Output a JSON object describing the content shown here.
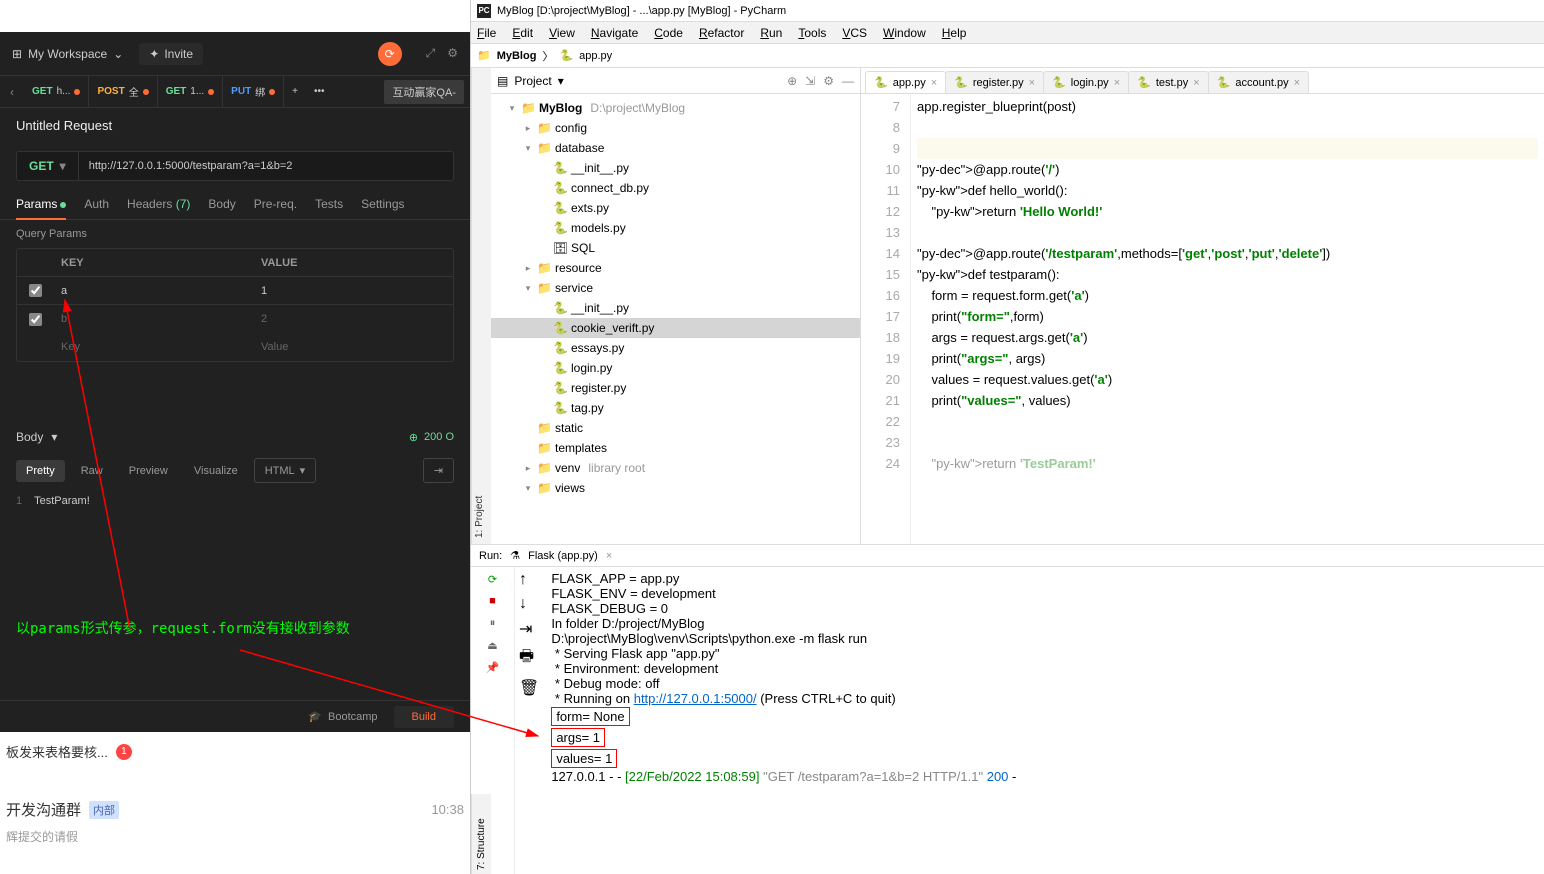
{
  "postman": {
    "workspace": "My Workspace",
    "invite": "Invite",
    "tabs": [
      {
        "method": "GET",
        "label": "h...",
        "color": "#6bdd9a"
      },
      {
        "method": "POST",
        "label": "全",
        "color": "#ffb13b"
      },
      {
        "method": "GET",
        "label": "1...",
        "color": "#6bdd9a"
      },
      {
        "method": "PUT",
        "label": "绑",
        "color": "#4a9eff"
      }
    ],
    "tab_extra": "+",
    "tab_more": "•••",
    "env": "互动赢家QA-",
    "request_name": "Untitled Request",
    "method": "GET",
    "url": "http://127.0.0.1:5000/testparam?a=1&b=2",
    "req_tabs": {
      "params": "Params",
      "auth": "Auth",
      "headers": "Headers",
      "headers_count": "(7)",
      "body": "Body",
      "prereq": "Pre-req.",
      "tests": "Tests",
      "settings": "Settings"
    },
    "query_params": "Query Params",
    "th_key": "KEY",
    "th_val": "VALUE",
    "params_data": [
      {
        "k": "a",
        "v": "1",
        "checked": true
      },
      {
        "k": "b",
        "v": "2",
        "checked": true
      }
    ],
    "key_ph": "Key",
    "val_ph": "Value",
    "body_label": "Body",
    "status": "200 O",
    "resp_tabs": {
      "pretty": "Pretty",
      "raw": "Raw",
      "preview": "Preview",
      "visualize": "Visualize",
      "html": "HTML"
    },
    "resp_body": "TestParam!",
    "annotation": "以params形式传参，request.form没有接收到参数",
    "bootcamp": "Bootcamp",
    "build": "Build"
  },
  "bg": {
    "row1": "板发来表格要核...",
    "badge": "1",
    "row2": "开发沟通群",
    "tag": "内部",
    "time": "10:38",
    "row3": "辉提交的请假"
  },
  "pycharm": {
    "title": "MyBlog [D:\\project\\MyBlog] - ...\\app.py [MyBlog] - PyCharm",
    "menus": [
      "File",
      "Edit",
      "View",
      "Navigate",
      "Code",
      "Refactor",
      "Run",
      "Tools",
      "VCS",
      "Window",
      "Help"
    ],
    "crumb_proj": "MyBlog",
    "crumb_file": "app.py",
    "sidebar_tab": "1: Project",
    "project_label": "Project",
    "tree": [
      {
        "ind": 1,
        "ar": "▾",
        "ic": "📁",
        "name": "MyBlog",
        "path": "D:\\project\\MyBlog",
        "b": true
      },
      {
        "ind": 2,
        "ar": "▸",
        "ic": "📁",
        "name": "config"
      },
      {
        "ind": 2,
        "ar": "▾",
        "ic": "📁",
        "name": "database"
      },
      {
        "ind": 3,
        "ar": "",
        "ic": "🐍",
        "name": "__init__.py"
      },
      {
        "ind": 3,
        "ar": "",
        "ic": "🐍",
        "name": "connect_db.py"
      },
      {
        "ind": 3,
        "ar": "",
        "ic": "🐍",
        "name": "exts.py"
      },
      {
        "ind": 3,
        "ar": "",
        "ic": "🐍",
        "name": "models.py"
      },
      {
        "ind": 3,
        "ar": "",
        "ic": "🗄",
        "name": "SQL"
      },
      {
        "ind": 2,
        "ar": "▸",
        "ic": "📁",
        "name": "resource"
      },
      {
        "ind": 2,
        "ar": "▾",
        "ic": "📁",
        "name": "service"
      },
      {
        "ind": 3,
        "ar": "",
        "ic": "🐍",
        "name": "__init__.py"
      },
      {
        "ind": 3,
        "ar": "",
        "ic": "🐍",
        "name": "cookie_verift.py",
        "sel": true
      },
      {
        "ind": 3,
        "ar": "",
        "ic": "🐍",
        "name": "essays.py"
      },
      {
        "ind": 3,
        "ar": "",
        "ic": "🐍",
        "name": "login.py"
      },
      {
        "ind": 3,
        "ar": "",
        "ic": "🐍",
        "name": "register.py"
      },
      {
        "ind": 3,
        "ar": "",
        "ic": "🐍",
        "name": "tag.py"
      },
      {
        "ind": 2,
        "ar": "",
        "ic": "📁",
        "name": "static"
      },
      {
        "ind": 2,
        "ar": "",
        "ic": "📁",
        "name": "templates"
      },
      {
        "ind": 2,
        "ar": "▸",
        "ic": "📁",
        "name": "venv",
        "path": "library root"
      },
      {
        "ind": 2,
        "ar": "▾",
        "ic": "📁",
        "name": "views"
      }
    ],
    "editor_tabs": [
      {
        "name": "app.py",
        "active": true
      },
      {
        "name": "register.py"
      },
      {
        "name": "login.py"
      },
      {
        "name": "test.py"
      },
      {
        "name": "account.py"
      }
    ],
    "code": {
      "start": 7,
      "lines": [
        {
          "n": 7,
          "t": "app.register_blueprint(post)"
        },
        {
          "n": 8,
          "t": ""
        },
        {
          "n": 9,
          "t": "",
          "hl": true
        },
        {
          "n": 10,
          "t": "@app.route('/')",
          "dec": true
        },
        {
          "n": 11,
          "t": "def hello_world():",
          "def": true
        },
        {
          "n": 12,
          "t": "    return 'Hello World!'",
          "ret": true
        },
        {
          "n": 13,
          "t": ""
        },
        {
          "n": 14,
          "t": "@app.route('/testparam',methods=['get','post','put','delete'])",
          "dec": true
        },
        {
          "n": 15,
          "t": "def testparam():",
          "def": true
        },
        {
          "n": 16,
          "t": "    form = request.form.get('a')"
        },
        {
          "n": 17,
          "t": "    print(\"form=\",form)"
        },
        {
          "n": 18,
          "t": "    args = request.args.get('a')"
        },
        {
          "n": 19,
          "t": "    print(\"args=\", args)"
        },
        {
          "n": 20,
          "t": "    values = request.values.get('a')"
        },
        {
          "n": 21,
          "t": "    print(\"values=\", values)"
        },
        {
          "n": 22,
          "t": ""
        },
        {
          "n": 23,
          "t": ""
        },
        {
          "n": 24,
          "t": "    return 'TestParam!'",
          "ret": true,
          "cut": true
        }
      ]
    },
    "run_label": "Run:",
    "run_config": "Flask (app.py)",
    "console": [
      "FLASK_APP = app.py",
      "FLASK_ENV = development",
      "FLASK_DEBUG = 0",
      "In folder D:/project/MyBlog",
      "D:\\project\\MyBlog\\venv\\Scripts\\python.exe -m flask run",
      " * Serving Flask app \"app.py\"",
      " * Environment: development",
      " * Debug mode: off",
      " * Running on http://127.0.0.1:5000/ (Press CTRL+C to quit)",
      "form= None",
      "args= 1",
      "values= 1",
      "127.0.0.1 - - [22/Feb/2022 15:08:59] \"GET /testparam?a=1&b=2 HTTP/1.1\" 200 -"
    ],
    "struct_tab": "7: Structure"
  }
}
